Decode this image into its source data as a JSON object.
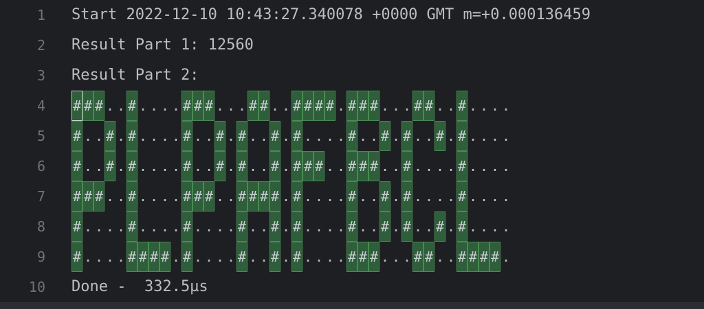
{
  "editor": {
    "lines": [
      {
        "number": "1",
        "text": "Start 2022-12-10 10:43:27.340078 +0000 GMT m=+0.000136459"
      },
      {
        "number": "2",
        "text": "Result Part 1: 12560"
      },
      {
        "number": "3",
        "text": "Result Part 2:"
      },
      {
        "number": "4",
        "text": "###..#....###...##..####.###...##..#...."
      },
      {
        "number": "5",
        "text": "#..#.#....#..#.#..#.#....#..#.#..#.#...."
      },
      {
        "number": "6",
        "text": "#..#.#....#..#.#..#.###..###..#....#...."
      },
      {
        "number": "7",
        "text": "###..#....###..####.#....#..#.#....#...."
      },
      {
        "number": "8",
        "text": "#....#....#....#..#.#....#..#.#..#.#...."
      },
      {
        "number": "9",
        "text": "#....####.#....#..#.#....###...##..####."
      },
      {
        "number": "10",
        "text": "Done -  332.5µs"
      }
    ]
  },
  "colors": {
    "background": "#1e1f22",
    "text": "#bcbec4",
    "line_number": "#6f737a",
    "hash_highlight": "#2e5f3a"
  }
}
